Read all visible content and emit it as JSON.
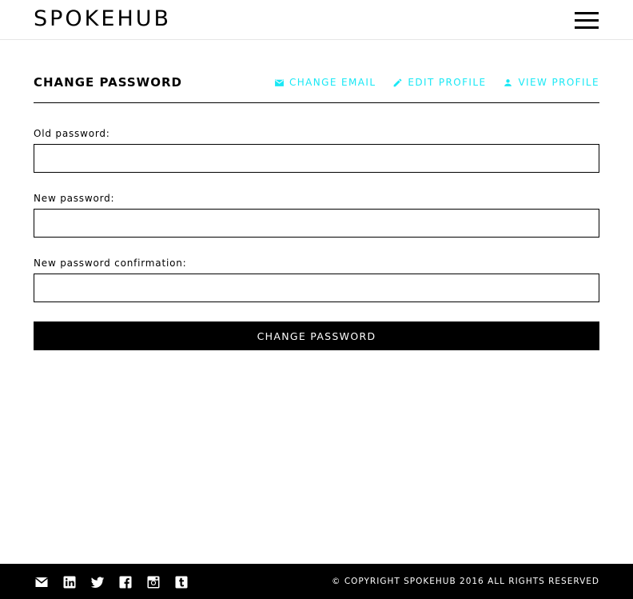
{
  "header": {
    "logo": "SPOKEHUB",
    "menu_icon": "hamburger-menu-icon"
  },
  "page": {
    "title": "CHANGE PASSWORD",
    "nav": [
      {
        "label": "CHANGE EMAIL",
        "icon": "envelope-icon"
      },
      {
        "label": "EDIT PROFILE",
        "icon": "pencil-icon"
      },
      {
        "label": "VIEW PROFILE",
        "icon": "person-icon"
      }
    ],
    "accent_color": "#19e8f5"
  },
  "form": {
    "old_password_label": "Old password:",
    "old_password_value": "",
    "new_password_label": "New password:",
    "new_password_value": "",
    "confirm_label": "New password confirmation:",
    "confirm_value": "",
    "submit_label": "CHANGE PASSWORD"
  },
  "footer": {
    "social": [
      "mail-icon",
      "linkedin-icon",
      "twitter-icon",
      "facebook-icon",
      "instagram-icon",
      "tumblr-icon"
    ],
    "copyright": "© COPYRIGHT SPOKEHUB 2016 ALL RIGHTS RESERVED"
  }
}
